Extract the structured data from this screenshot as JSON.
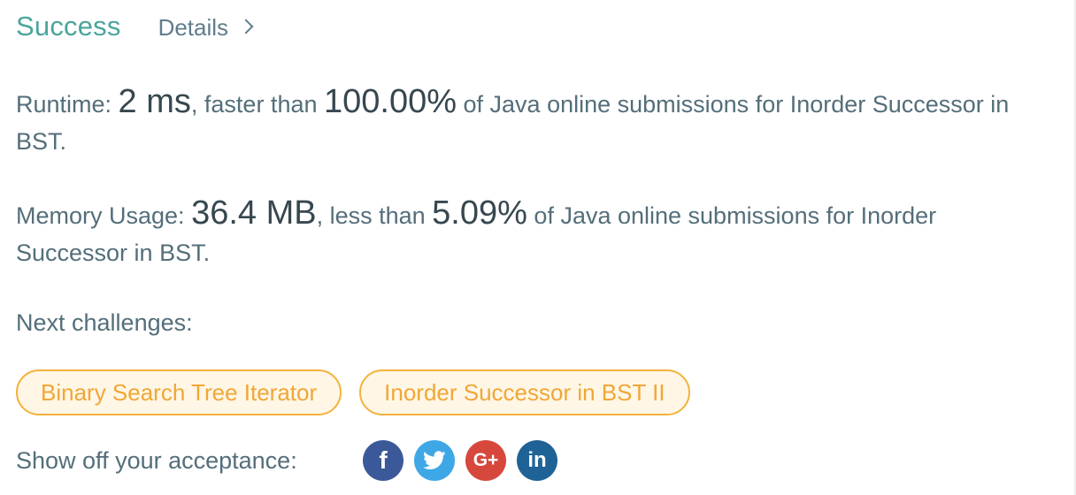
{
  "header": {
    "status": "Success",
    "details_label": "Details"
  },
  "runtime": {
    "label": "Runtime: ",
    "value": "2 ms",
    "mid": ", faster than ",
    "percent": "100.00%",
    "suffix": " of Java online submissions for Inorder Successor in BST."
  },
  "memory": {
    "label": "Memory Usage: ",
    "value": "36.4 MB",
    "mid": ", less than ",
    "percent": "5.09%",
    "suffix": " of Java online submissions for Inorder Successor in BST."
  },
  "next": {
    "label": "Next challenges:",
    "items": [
      {
        "label": "Binary Search Tree Iterator"
      },
      {
        "label": "Inorder Successor in BST II"
      }
    ]
  },
  "share": {
    "label": "Show off your acceptance:",
    "icons": [
      {
        "name": "facebook-icon",
        "glyph": "f",
        "color": "#3b5998"
      },
      {
        "name": "twitter-icon",
        "color": "#3ea8e6"
      },
      {
        "name": "google-plus-icon",
        "glyph": "G+",
        "color": "#d6473c"
      },
      {
        "name": "linkedin-icon",
        "glyph": "in",
        "color": "#1f6296"
      }
    ]
  },
  "colors": {
    "success": "#4aa59a",
    "text": "#546e7a",
    "pill_border": "#f3b23c",
    "pill_bg": "#fff6e6"
  }
}
